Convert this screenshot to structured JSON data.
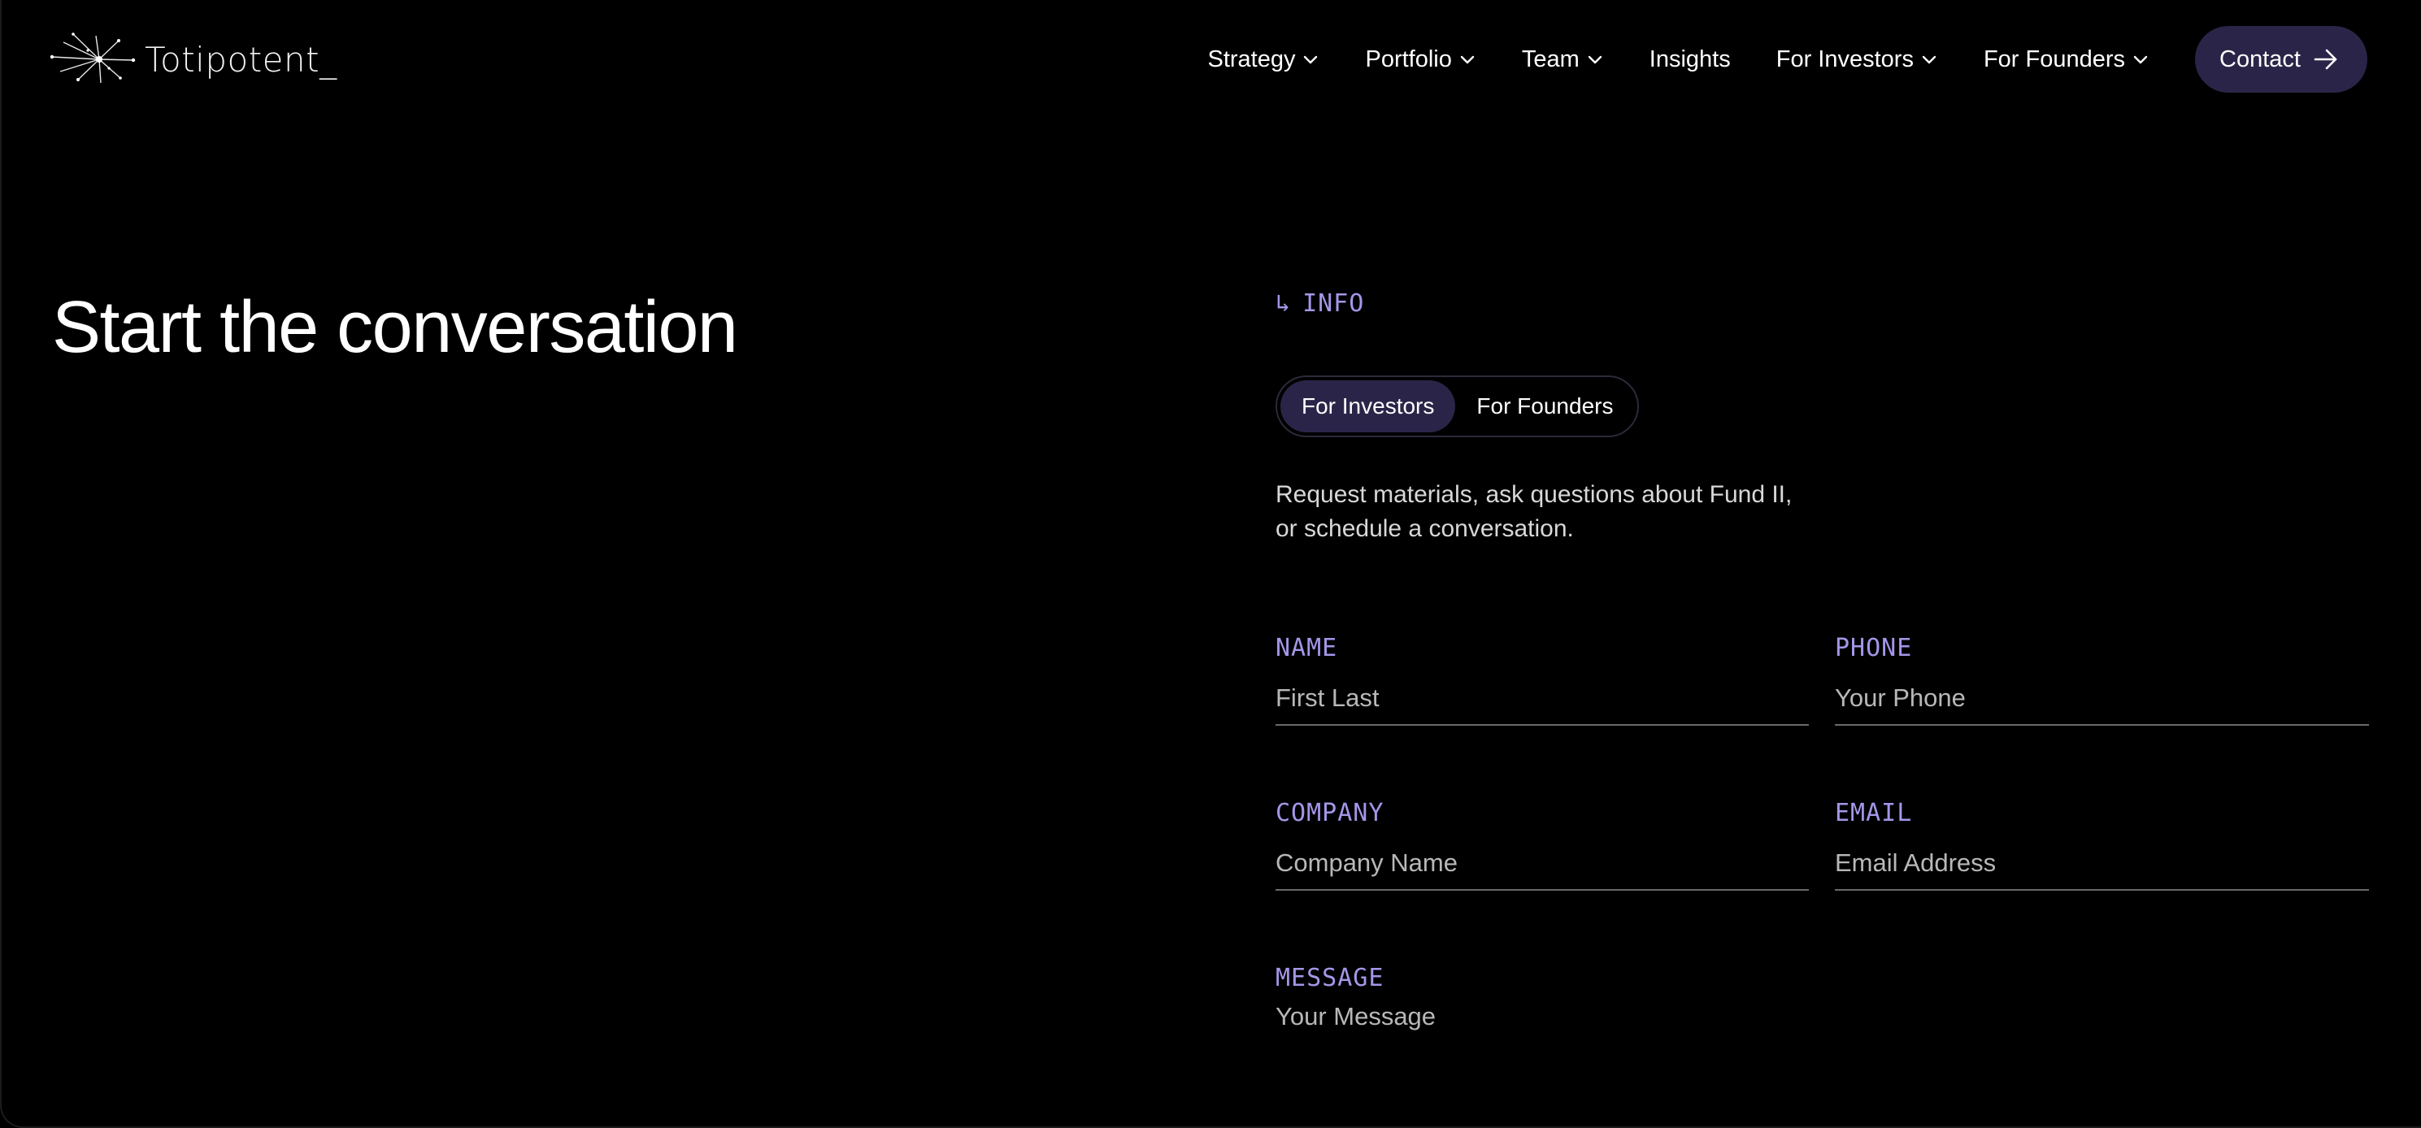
{
  "brand": {
    "name": "Totipotent_"
  },
  "nav": {
    "items": [
      {
        "label": "Strategy",
        "has_dropdown": true
      },
      {
        "label": "Portfolio",
        "has_dropdown": true
      },
      {
        "label": "Team",
        "has_dropdown": true
      },
      {
        "label": "Insights",
        "has_dropdown": false
      },
      {
        "label": "For Investors",
        "has_dropdown": true
      },
      {
        "label": "For Founders",
        "has_dropdown": true
      }
    ],
    "contact_label": "Contact"
  },
  "hero": {
    "title": "Start the conversation"
  },
  "form": {
    "section_tag": "INFO",
    "section_tag_icon": "return-arrow-icon",
    "toggle": {
      "options": [
        "For Investors",
        "For Founders"
      ],
      "selected": "For Investors"
    },
    "intro": "Request materials, ask questions about Fund II, or schedule a conversation.",
    "fields": {
      "name": {
        "label": "NAME",
        "placeholder": "First Last",
        "value": ""
      },
      "phone": {
        "label": "PHONE",
        "placeholder": "Your Phone",
        "value": ""
      },
      "company": {
        "label": "COMPANY",
        "placeholder": "Company Name",
        "value": ""
      },
      "email": {
        "label": "EMAIL",
        "placeholder": "Email Address",
        "value": ""
      },
      "message": {
        "label": "MESSAGE",
        "placeholder": "Your Message",
        "value": ""
      }
    }
  },
  "colors": {
    "background": "#000000",
    "accent_label": "#a596e8",
    "pill_active": "#2a2548",
    "input_underline": "#6a6a6a"
  }
}
